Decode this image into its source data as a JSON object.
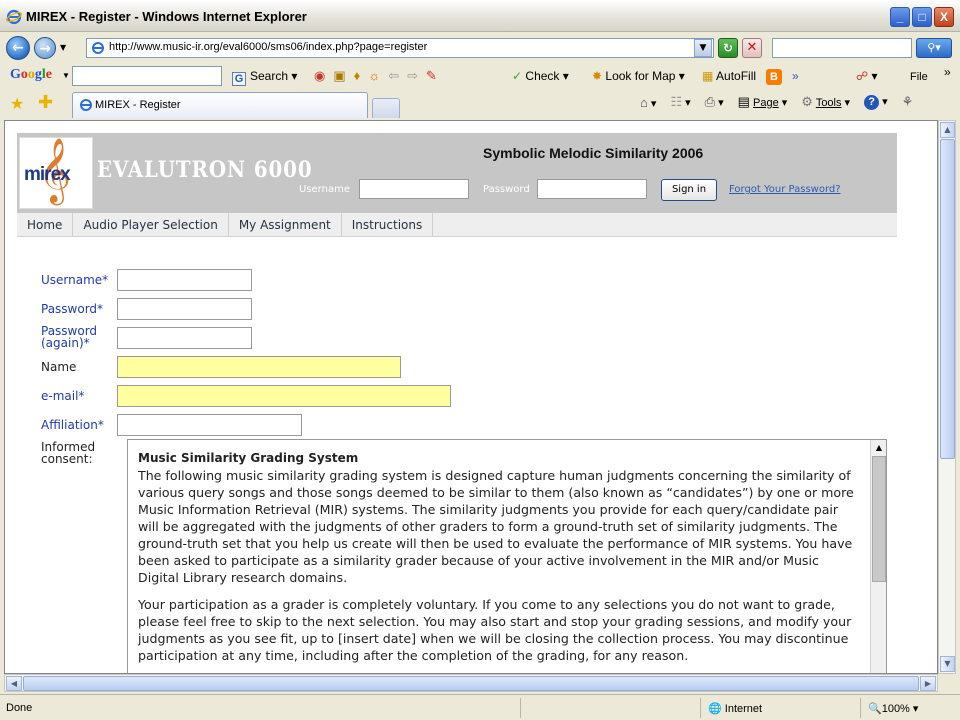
{
  "window": {
    "title": "MIREX - Register - Windows Internet Explorer",
    "buttons": [
      "_",
      "□",
      "X"
    ]
  },
  "address_bar": {
    "url": "http://www.music-ir.org/eval6000/sms06/index.php?page=register"
  },
  "google_bar": {
    "logo": [
      "G",
      "o",
      "o",
      "g",
      "l",
      "e"
    ],
    "search_label": "Search",
    "check_label": "Check",
    "look_for_map_label": "Look for Map",
    "autofill_label": "AutoFill",
    "file_menu": "File"
  },
  "tabs": [
    {
      "label": "MIREX - Register"
    }
  ],
  "command_bar": {
    "page_label": "Page",
    "tools_label": "Tools"
  },
  "site": {
    "brand": "EVALUTRON 6000",
    "logo_text": "mirex",
    "title": "Symbolic Melodic Similarity 2006",
    "login": {
      "username_label": "Username",
      "password_label": "Password",
      "signin_label": "Sign in",
      "forgot_label": "Forgot Your Password?"
    },
    "nav": [
      "Home",
      "Audio Player Selection",
      "My Assignment",
      "Instructions"
    ]
  },
  "form": {
    "username_label": "Username*",
    "password_label": "Password*",
    "password_again_label_1": "Password",
    "password_again_label_2": "(again)*",
    "name_label": "Name",
    "email_label": "e-mail*",
    "affiliation_label": "Affiliation*",
    "consent_label_1": "Informed",
    "consent_label_2": "consent:"
  },
  "consent": {
    "heading": "Music Similarity Grading System",
    "p1": "The following music similarity grading system is designed capture human judgments concerning the similarity of various query songs and those songs deemed to be similar to them (also known as “candidates”) by one or more Music Information Retrieval (MIR) systems. The similarity judgments you provide for each query/candidate pair will be aggregated with the judgments of other graders to form a ground-truth set of similarity judgments. The ground-truth set that you help us create will then be used to evaluate the performance of MIR systems. You have been asked to participate as a similarity grader because of your active involvement in the MIR and/or Music Digital Library research domains.",
    "p2": "Your participation as a grader is completely voluntary. If you come to any selections you do not want to grade, please feel free to skip to the next selection. You may also start and stop your grading sessions, and modify your judgments as you see fit, up to [insert date]  when we will be closing the collection process. You may discontinue participation at any time, including after the completion of the grading, for any reason."
  },
  "status_bar": {
    "status": "Done",
    "zone": "Internet",
    "zoom": "100%"
  }
}
